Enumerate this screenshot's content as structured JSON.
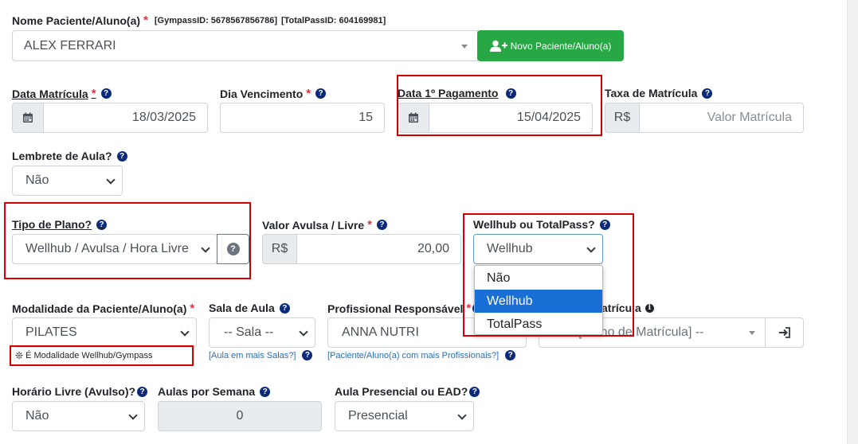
{
  "patient": {
    "label": "Nome Paciente/Aluno(a)",
    "gympass_id": "[GympassID: 5678567856786]",
    "totalpass_id": "[TotalPassID: 604169981]",
    "value": "ALEX FERRARI",
    "new_button": "Novo Paciente/Aluno(a)"
  },
  "dates": {
    "matricula_label": "Data Matrícula",
    "matricula_value": "18/03/2025",
    "vencimento_label": "Dia Vencimento",
    "vencimento_value": "15",
    "pagamento_label": "Data 1º Pagamento",
    "pagamento_value": "15/04/2025",
    "taxa_label": "Taxa de Matrícula",
    "taxa_prefix": "R$",
    "taxa_placeholder": "Valor Matrícula"
  },
  "lembrete": {
    "label": "Lembrete de Aula?",
    "value": "Não"
  },
  "plano": {
    "label": "Tipo de Plano?",
    "value": "Wellhub / Avulsa / Hora Livre",
    "help_glyph": "?"
  },
  "avulsa": {
    "label": "Valor Avulsa / Livre",
    "prefix": "R$",
    "value": "20,00"
  },
  "wellhub": {
    "label": "Wellhub ou TotalPass?",
    "value": "Wellhub",
    "options": [
      "Não",
      "Wellhub",
      "TotalPass"
    ]
  },
  "modalidade": {
    "label": "Modalidade da Paciente/Aluno(a)",
    "value": "PILATES",
    "note_glyph": "❊",
    "note": "É Modalidade Wellhub/Gympass"
  },
  "sala": {
    "label": "Sala de Aula",
    "value": "-- Sala --",
    "link": "[Aula em mais Salas?]"
  },
  "profissional": {
    "label": "Profissional Responsável",
    "value": "ANNA NUTRI",
    "link": "[Paciente/Aluno(a) com mais Profissionais?]"
  },
  "plano_matricula": {
    "label_visible": "atrícula",
    "value_visible": "-- [Plano de Matrícula] --"
  },
  "horario": {
    "label": "Horário Livre (Avulso)?",
    "value": "Não"
  },
  "aulas": {
    "label": "Aulas por Semana",
    "value": "0"
  },
  "presencial": {
    "label": "Aula Presencial ou EAD?",
    "value": "Presencial"
  },
  "colors": {
    "accent_green": "#28a745",
    "highlight_red": "#d40000",
    "help_blue": "#0b2a7a",
    "dropdown_selected": "#1a6fd6"
  }
}
